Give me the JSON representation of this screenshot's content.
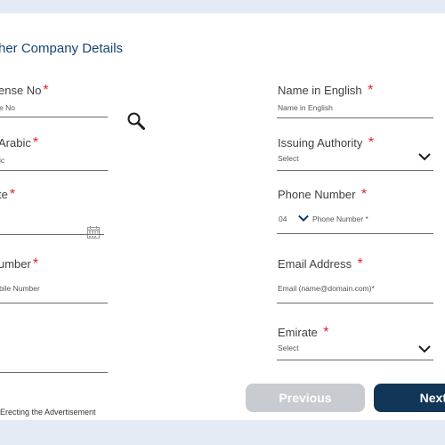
{
  "page": {
    "title": "her Company Details"
  },
  "left": {
    "license": {
      "label": "ense No",
      "req": "*",
      "placeholder": "e No"
    },
    "name_arabic": {
      "label": "Arabic",
      "req": "*",
      "placeholder": "ic"
    },
    "date": {
      "label": "te",
      "req": "*",
      "placeholder": ""
    },
    "mobile": {
      "label": "umber",
      "req": "*",
      "placeholder": "bile Number"
    },
    "terms_text": "Erecting the Advertisement"
  },
  "right": {
    "name_english": {
      "label": "Name in English",
      "req": "*",
      "placeholder": "Name in English"
    },
    "issuing_authority": {
      "label": "Issuing Authority",
      "req": "*",
      "value": "Select"
    },
    "phone": {
      "label": "Phone Number",
      "req": "*",
      "code": "04",
      "placeholder": "Phone Number *"
    },
    "email": {
      "label": "Email Address",
      "req": "*",
      "placeholder": "Email (name@domain.com)*"
    },
    "emirate": {
      "label": "Emirate",
      "req": "*",
      "value": "Select"
    }
  },
  "buttons": {
    "previous": "Previous",
    "next": "Next"
  },
  "colors": {
    "background": "#e4ebf4",
    "title": "#17456f",
    "required": "#e0212f",
    "next_button": "#113657",
    "previous_button": "#c8cbcf"
  }
}
